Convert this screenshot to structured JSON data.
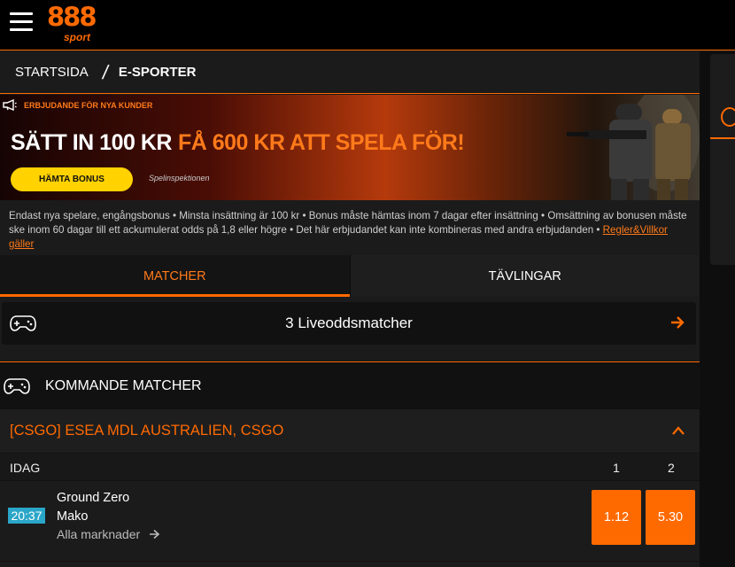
{
  "header": {
    "logo_number": "888",
    "logo_sport": "sport"
  },
  "breadcrumb": {
    "home": "STARTSIDA",
    "separator": "/",
    "current": "E-SPORTER"
  },
  "banner": {
    "tag": "ERBJUDANDE FÖR NYA KUNDER",
    "headline_white": "SÄTT IN 100 KR",
    "headline_orange": "FÅ 600 KR ATT SPELA FÖR!",
    "button_label": "HÄMTA BONUS",
    "regulator": "Spelinspektionen"
  },
  "terms": {
    "text": "Endast nya spelare, engångsbonus • Minsta insättning är 100 kr • Bonus måste hämtas inom 7 dagar efter insättning • Omsättning av bonusen måste ske inom 60 dagar till ett ackumulerat odds på 1,8 eller högre • Det här erbjudandet kan inte kombineras med andra erbjudanden •",
    "link": "Regler&Villkor gäller"
  },
  "tabs": [
    {
      "label": "MATCHER",
      "active": true
    },
    {
      "label": "TÄVLINGAR",
      "active": false
    }
  ],
  "live": {
    "label": "3 Liveoddsmatcher",
    "icon": "gamepad-icon"
  },
  "upcoming": {
    "title": "KOMMANDE MATCHER",
    "icon": "gamepad-icon"
  },
  "league": {
    "title": "[CSGO] ESEA MDL AUSTRALIEN, CSGO"
  },
  "day": {
    "label": "IDAG",
    "col1": "1",
    "col2": "2"
  },
  "matches": [
    {
      "time": "20:37",
      "team1": "Ground Zero",
      "team2": "Mako",
      "all_markets": "Alla marknader",
      "odd1": "1.12",
      "odd2": "5.30"
    }
  ],
  "colors": {
    "accent": "#ff6a00",
    "time_badge": "#2aa6c8",
    "button_yellow": "#ffd200"
  }
}
